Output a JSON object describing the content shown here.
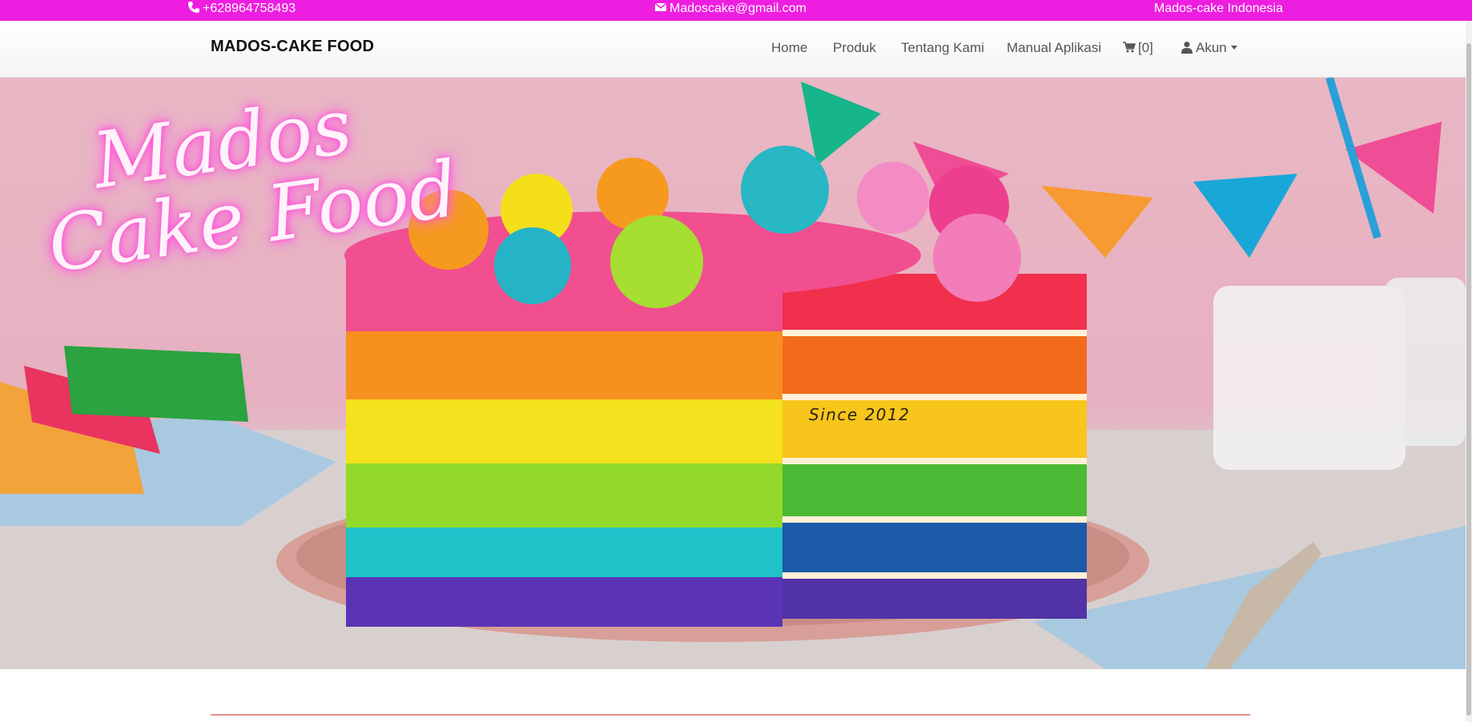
{
  "topbar": {
    "phone": "+628964758493",
    "email": "Madoscake@gmail.com",
    "country": "Mados-cake Indonesia",
    "phone_icon": "phone-icon",
    "email_icon": "envelope-icon",
    "background": "#ee1ee0"
  },
  "navbar": {
    "brand": "MADOS-CAKE FOOD",
    "items": {
      "home": "Home",
      "produk": "Produk",
      "tentang": "Tentang Kami",
      "manual": "Manual Aplikasi",
      "cart": "[0]",
      "akun": "Akun"
    },
    "cart_icon": "shopping-cart-icon",
    "akun_icon": "user-icon"
  },
  "hero": {
    "script_line1": "Mados",
    "script_line2": "Cake Food",
    "since": "Since 2012"
  },
  "colors": {
    "accent": "#ee1ee0",
    "rule": "#e98a8a"
  }
}
